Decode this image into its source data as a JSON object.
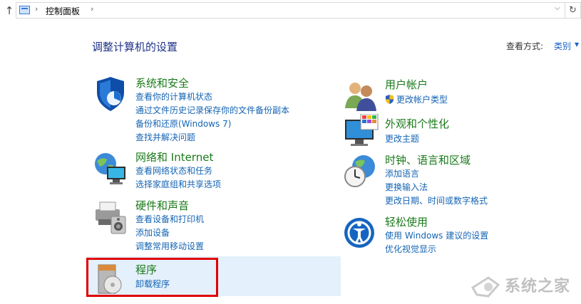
{
  "address_bar": {
    "path": "控制面板",
    "up_icon": "up-arrow-icon",
    "refresh_icon": "refresh-icon"
  },
  "header": {
    "title": "调整计算机的设置",
    "view_by_label": "查看方式:",
    "view_by_value": "类别"
  },
  "categories": {
    "system": {
      "title": "系统和安全",
      "links": [
        "查看你的计算机状态",
        "通过文件历史记录保存你的文件备份副本",
        "备份和还原(Windows 7)",
        "查找并解决问题"
      ]
    },
    "network": {
      "title": "网络和 Internet",
      "links": [
        "查看网络状态和任务",
        "选择家庭组和共享选项"
      ]
    },
    "hardware": {
      "title": "硬件和声音",
      "links": [
        "查看设备和打印机",
        "添加设备",
        "调整常用移动设置"
      ]
    },
    "programs": {
      "title": "程序",
      "links": [
        "卸载程序"
      ]
    },
    "users": {
      "title": "用户帐户",
      "links": [
        "更改帐户类型"
      ]
    },
    "appearance": {
      "title": "外观和个性化",
      "links": [
        "更改主题"
      ]
    },
    "clock": {
      "title": "时钟、语言和区域",
      "links": [
        "添加语言",
        "更换输入法",
        "更改日期、时间或数字格式"
      ]
    },
    "ease": {
      "title": "轻松使用",
      "links": [
        "使用 Windows 建议的设置",
        "优化视觉显示"
      ]
    }
  },
  "watermark": {
    "text": "系统之家"
  },
  "colors": {
    "title_green": "#1a7a1a",
    "link_blue": "#1464b4",
    "header_blue": "#1e3287",
    "highlight": "#e4f0fb",
    "red_box": "#e00000"
  }
}
